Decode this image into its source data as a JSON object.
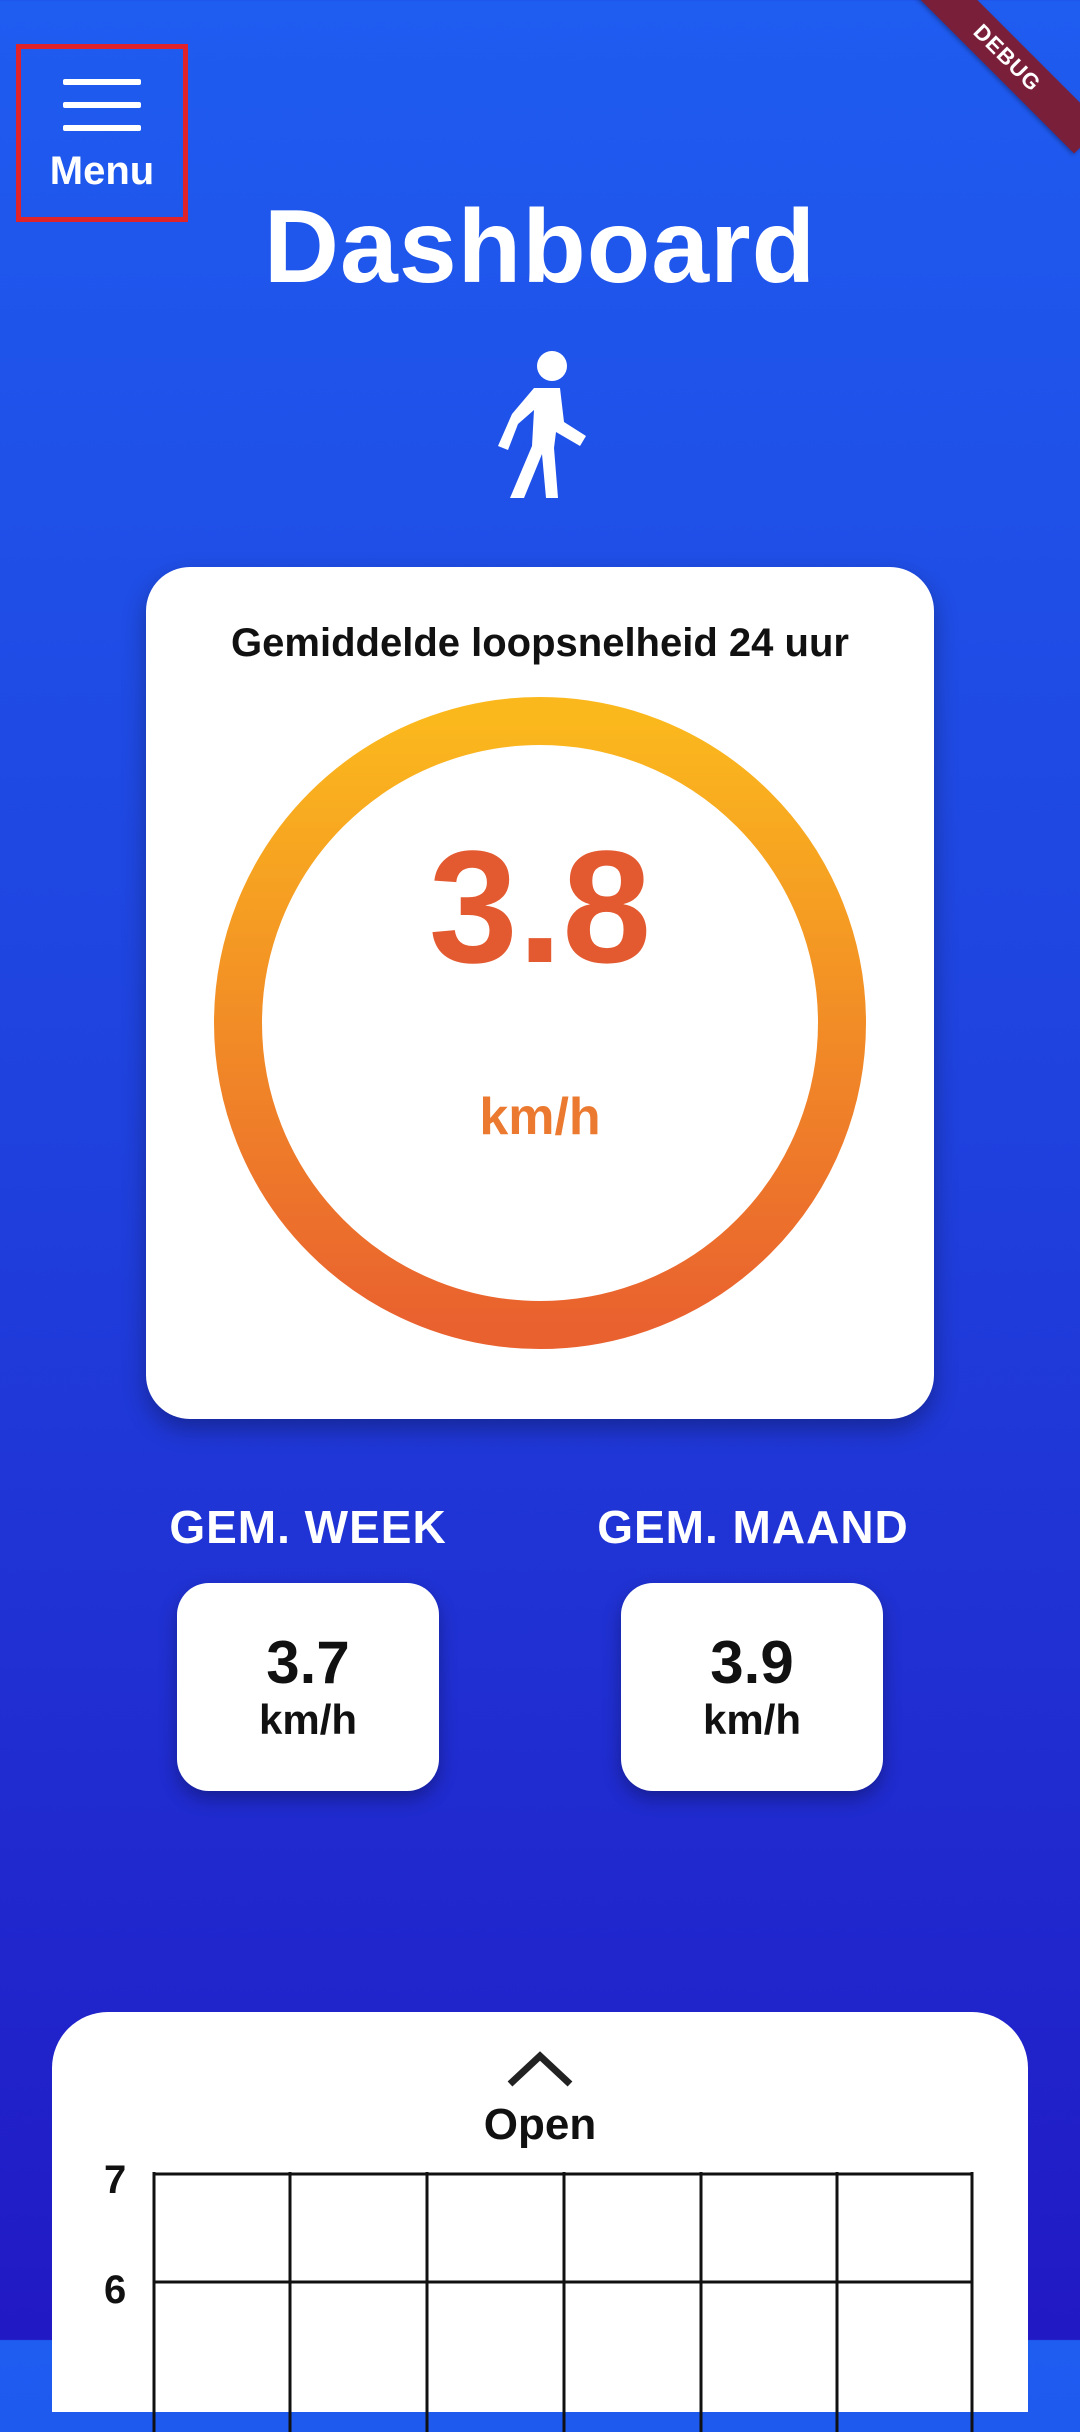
{
  "debug_banner": "DEBUG",
  "menu": {
    "label": "Menu",
    "icon": "hamburger-icon"
  },
  "page_title": "Dashboard",
  "hero_icon": "walking-person-icon",
  "speed_card": {
    "title": "Gemiddelde loopsnelheid 24 uur",
    "value": "3.8",
    "unit": "km/h",
    "gradient_start": "#fbb81d",
    "gradient_end": "#e9612f"
  },
  "averages": [
    {
      "label": "GEM. WEEK",
      "value": "3.7",
      "unit": "km/h"
    },
    {
      "label": "GEM. MAAND",
      "value": "3.9",
      "unit": "km/h"
    }
  ],
  "bottom_panel": {
    "open_label": "Open",
    "icon": "chevron-up-icon",
    "y_ticks": [
      "7",
      "6"
    ]
  },
  "colors": {
    "background_top": "#1f5cf0",
    "background_bottom": "#2119c4",
    "menu_highlight": "#e0232b",
    "value_color": "#e45a30"
  }
}
